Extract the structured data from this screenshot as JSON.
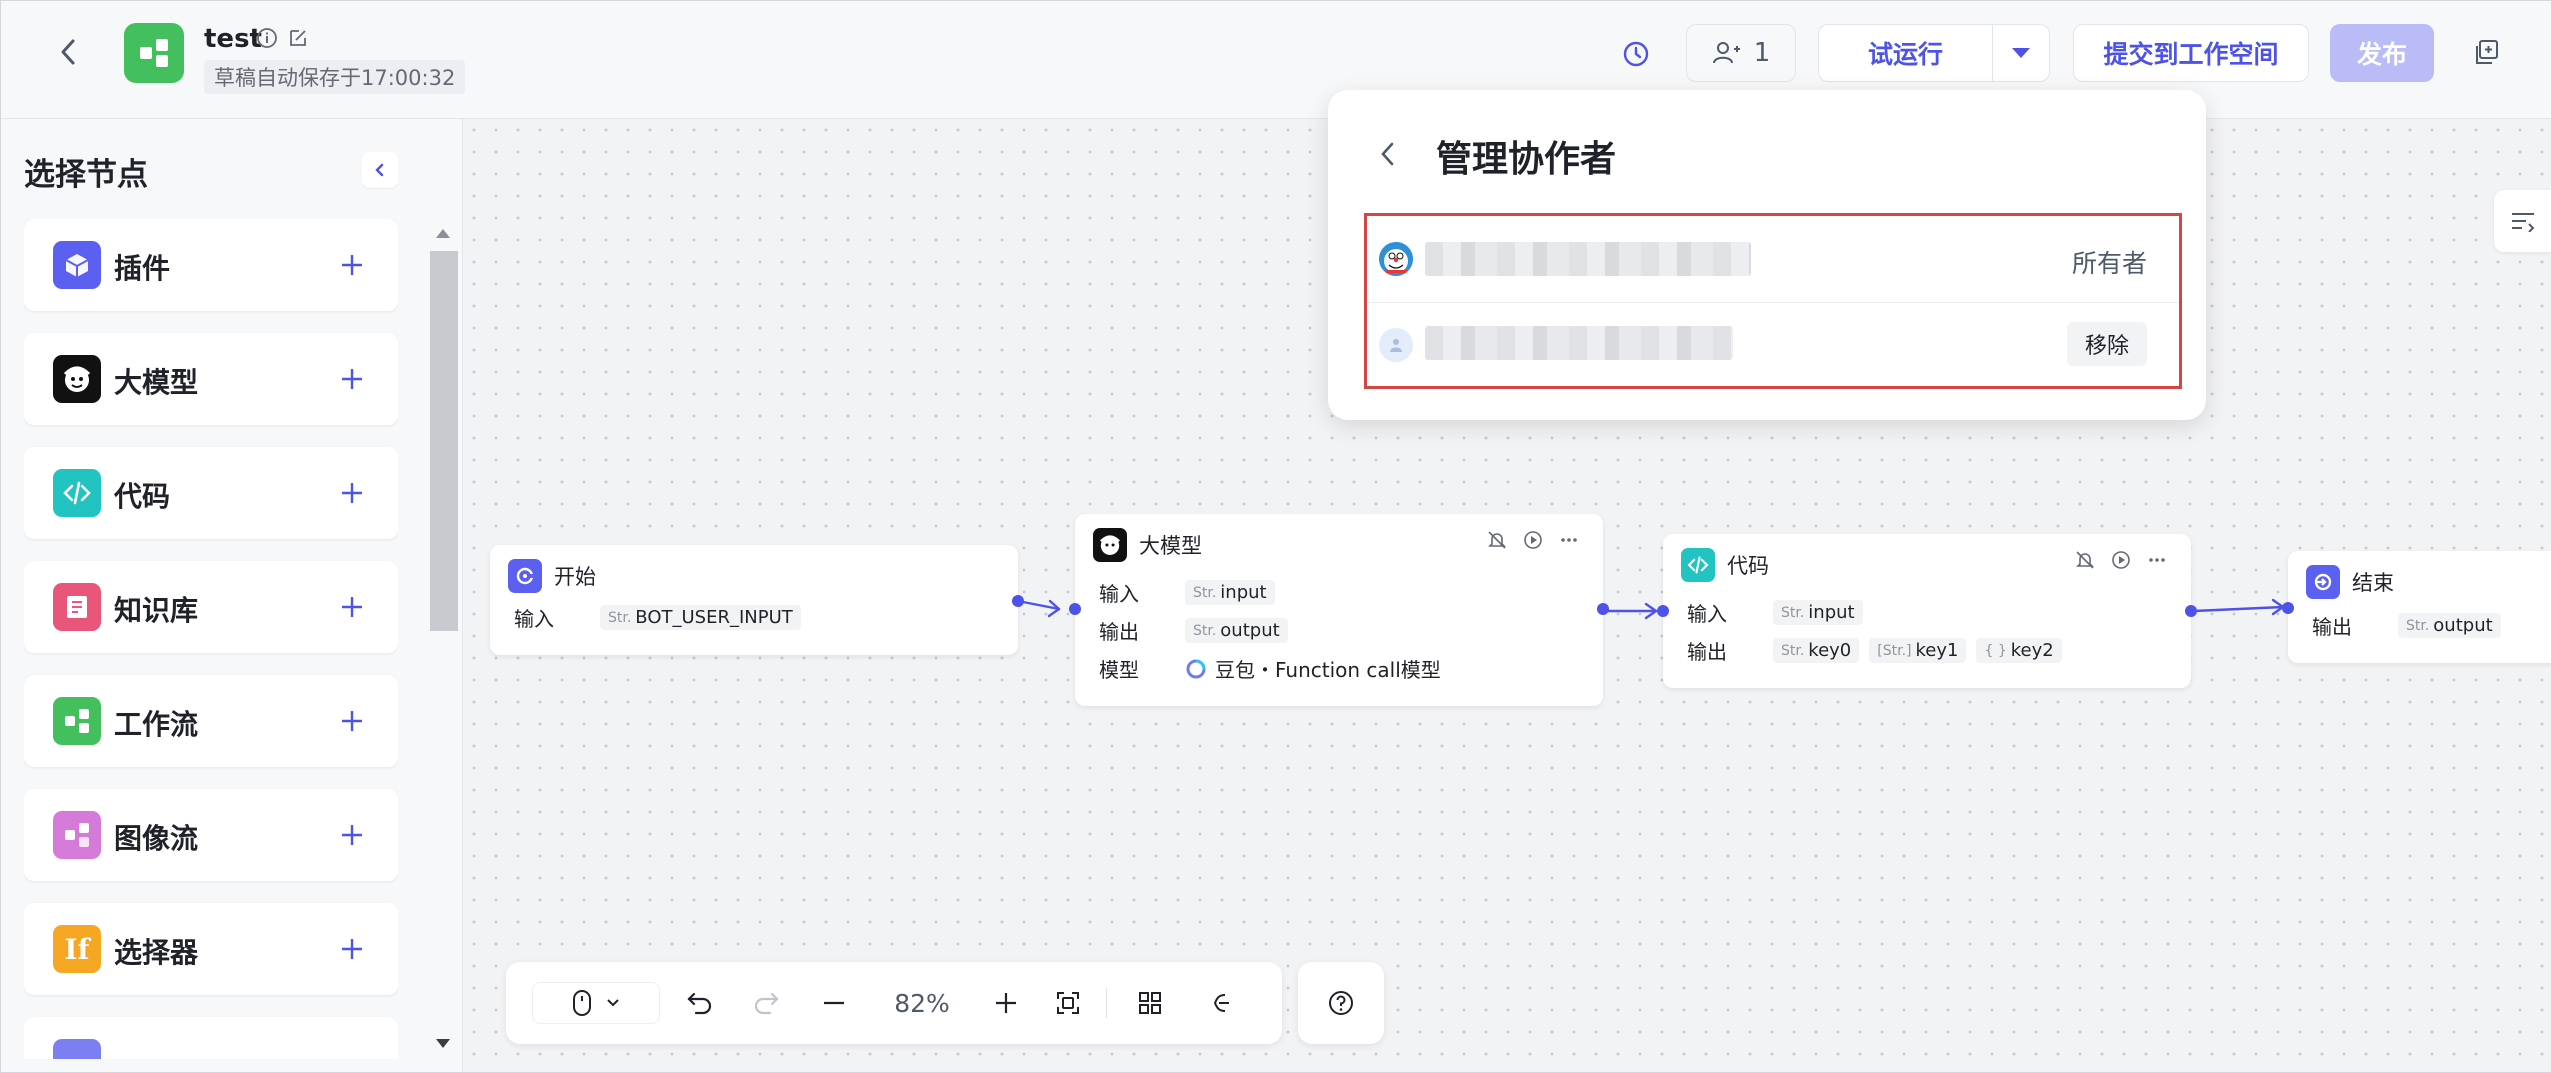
{
  "header": {
    "title": "test",
    "save_status": "草稿自动保存于17:00:32",
    "collaborator_count": "1",
    "trial_run_label": "试运行",
    "submit_label": "提交到工作空间",
    "publish_label": "发布"
  },
  "sidebar": {
    "title": "选择节点",
    "items": [
      {
        "label": "插件",
        "icon": "plugin-icon",
        "color": "#5b60f0"
      },
      {
        "label": "大模型",
        "icon": "llm-icon",
        "color": "#111111"
      },
      {
        "label": "代码",
        "icon": "code-icon",
        "color": "#23c3c1"
      },
      {
        "label": "知识库",
        "icon": "knowledge-icon",
        "color": "#e8567a"
      },
      {
        "label": "工作流",
        "icon": "workflow-icon",
        "color": "#43c05d"
      },
      {
        "label": "图像流",
        "icon": "imageflow-icon",
        "color": "#d67ad9"
      },
      {
        "label": "选择器",
        "icon": "selector-icon",
        "color": "#f5a623"
      }
    ]
  },
  "nodes": {
    "start": {
      "title": "开始",
      "input_label": "输入",
      "input_type": "Str.",
      "input_value": "BOT_USER_INPUT"
    },
    "llm": {
      "title": "大模型",
      "input_label": "输入",
      "input_type": "Str.",
      "input_value": "input",
      "output_label": "输出",
      "output_type": "Str.",
      "output_value": "output",
      "model_label": "模型",
      "model_value": "豆包・Function call模型"
    },
    "code": {
      "title": "代码",
      "input_label": "输入",
      "input_type": "Str.",
      "input_value": "input",
      "output_label": "输出",
      "outputs": [
        {
          "type": "Str.",
          "value": "key0"
        },
        {
          "type": "[Str.]",
          "value": "key1"
        },
        {
          "type": "{ }",
          "value": "key2"
        }
      ]
    },
    "end": {
      "title": "结束",
      "output_label": "输出",
      "output_type": "Str.",
      "output_value": "output"
    }
  },
  "toolbar": {
    "zoom": "82%"
  },
  "popup": {
    "title": "管理协作者",
    "owner_role": "所有者",
    "remove_label": "移除"
  },
  "colors": {
    "accent": "#4d53e8",
    "highlight_border": "#d64545",
    "publish_disabled": "#b9bcf6"
  }
}
